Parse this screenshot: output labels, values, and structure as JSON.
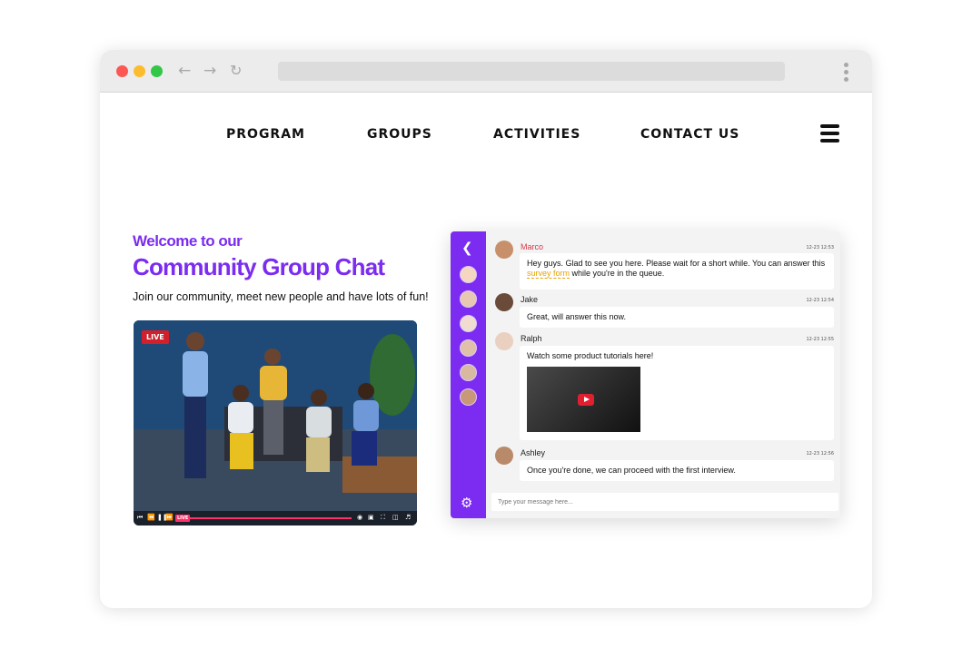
{
  "browser": {
    "back_icon": "arrow-left-icon",
    "forward_icon": "arrow-right-icon",
    "reload_icon": "reload-icon",
    "menu_icon": "kebab-menu-icon"
  },
  "nav": {
    "items": [
      {
        "label": "PROGRAM"
      },
      {
        "label": "GROUPS"
      },
      {
        "label": "ACTIVITIES"
      },
      {
        "label": "CONTACT US"
      }
    ],
    "burger_icon": "hamburger-menu-icon"
  },
  "hero": {
    "subtitle": "Welcome to our",
    "title": "Community Group Chat",
    "description": "Join our community, meet new people and have lots of fun!"
  },
  "video": {
    "badge": "LIVE",
    "controls_live": "LIVE",
    "progress": 1.0
  },
  "chat": {
    "messages": [
      {
        "name": "Marco",
        "time": "12-23 12:53",
        "text_before": "Hey guys. Glad to see you here. Please wait for a short while. You can answer this ",
        "link": "survey form",
        "text_after": " while you're in the queue."
      },
      {
        "name": "Jake",
        "time": "12-23 12:54",
        "text": "Great, will answer this now."
      },
      {
        "name": "Ralph",
        "time": "12-23 12:55",
        "text": "Watch some product tutorials here!"
      },
      {
        "name": "Ashley",
        "time": "12-23 12:56",
        "text": "Once you're done, we can proceed with the first interview."
      }
    ],
    "input_placeholder": "Type your message here...",
    "colors": {
      "accent": "#7b2cf0",
      "link": "#e8a200",
      "live": "#d0202c"
    }
  }
}
